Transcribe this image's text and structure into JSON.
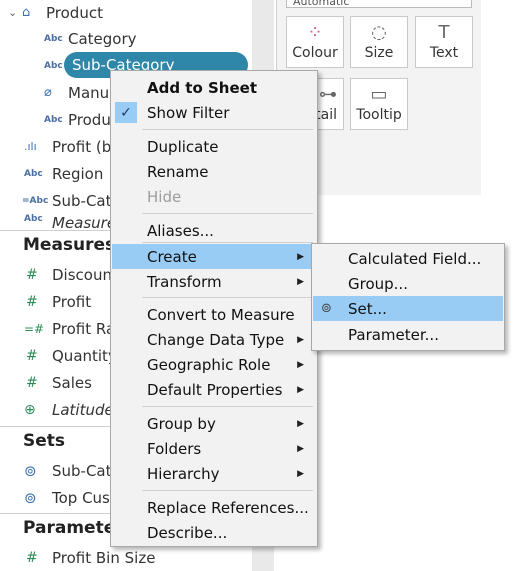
{
  "pane": {
    "dimensions": [
      {
        "label": "Product",
        "icon": "hierarchy-icon",
        "glyph": "⌂"
      },
      {
        "label": "Category",
        "icon": "abc-string-icon",
        "glyph": "Abc"
      },
      {
        "label": "Sub-Category",
        "icon": "abc-string-icon",
        "glyph": "Abc"
      },
      {
        "label": "Manu",
        "icon": "paperclip-icon",
        "glyph": "⌀"
      },
      {
        "label": "Produ",
        "icon": "abc-string-icon",
        "glyph": "Abc"
      },
      {
        "label": "Profit (b",
        "icon": "bin-chart-icon",
        "glyph": ".ılı"
      },
      {
        "label": "Region",
        "icon": "abc-string-icon",
        "glyph": "Abc"
      },
      {
        "label": "Sub-Cat",
        "icon": "abc-calculated-icon",
        "glyph": "=Abc"
      },
      {
        "label": "Measure",
        "icon": "abc-string-icon",
        "glyph": "Abc"
      }
    ],
    "measures_header": "Measures",
    "measures": [
      {
        "label": "Discoun",
        "glyph": "#"
      },
      {
        "label": "Profit",
        "glyph": "#"
      },
      {
        "label": "Profit Ra",
        "glyph": "=#"
      },
      {
        "label": "Quantity",
        "glyph": "#"
      },
      {
        "label": "Sales",
        "glyph": "#"
      },
      {
        "label": "Latitude",
        "glyph": "⊕"
      }
    ],
    "sets_header": "Sets",
    "sets": [
      {
        "label": "Sub-Cat",
        "glyph": "⊚"
      },
      {
        "label": "Top Cus",
        "glyph": "⊚"
      }
    ],
    "parameters_header": "Paramete",
    "parameters": [
      {
        "label": "Profit Bin Size",
        "glyph": "#"
      }
    ]
  },
  "marks": {
    "dropdown_value": "Automatic",
    "buttons": [
      {
        "label": "Colour",
        "glyph": "⁘"
      },
      {
        "label": "Size",
        "glyph": "◌"
      },
      {
        "label": "Text",
        "glyph": "T"
      },
      {
        "label": "tail",
        "glyph": "⊶"
      },
      {
        "label": "Tooltip",
        "glyph": "▭"
      }
    ]
  },
  "context_menu": {
    "add_to_sheet": "Add to Sheet",
    "show_filter": "Show Filter",
    "duplicate": "Duplicate",
    "rename": "Rename",
    "hide": "Hide",
    "aliases": "Aliases...",
    "create": "Create",
    "transform": "Transform",
    "convert_to_measure": "Convert to Measure",
    "change_data_type": "Change Data Type",
    "geographic_role": "Geographic Role",
    "default_properties": "Default Properties",
    "group_by": "Group by",
    "folders": "Folders",
    "hierarchy": "Hierarchy",
    "replace_references": "Replace References...",
    "describe": "Describe..."
  },
  "submenu": {
    "calculated_field": "Calculated Field...",
    "group": "Group...",
    "set": "Set...",
    "parameter": "Parameter..."
  },
  "colors": {
    "selected_pill": "#2e87a8",
    "menu_highlight": "#99ccf5"
  }
}
